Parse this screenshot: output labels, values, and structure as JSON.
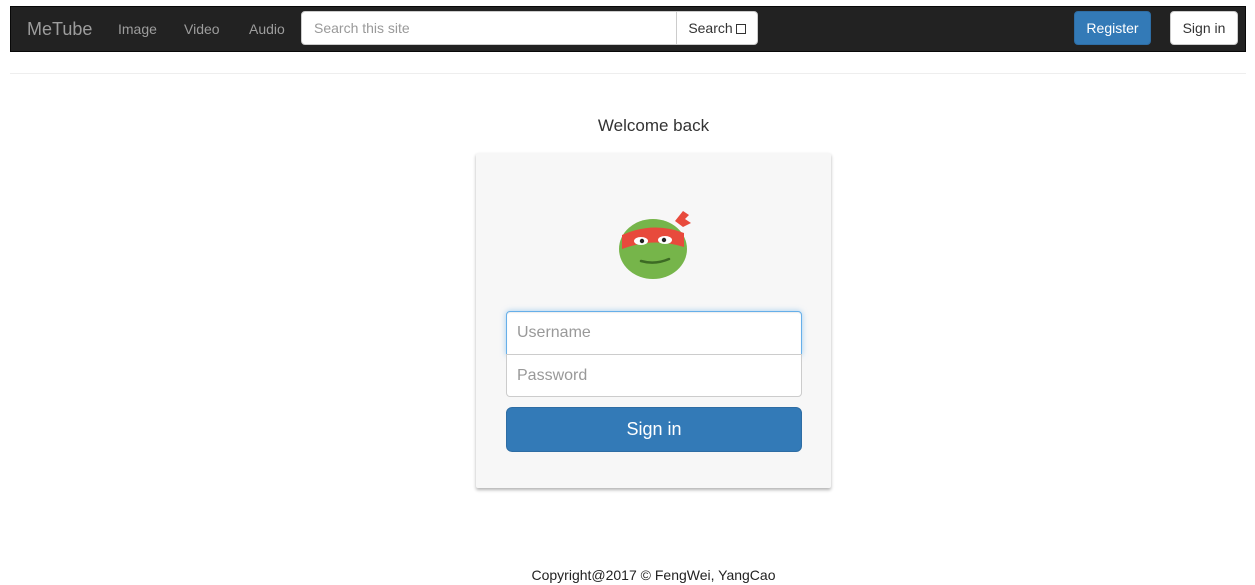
{
  "navbar": {
    "brand": "MeTube",
    "links": [
      "Image",
      "Video",
      "Audio"
    ],
    "search_placeholder": "Search this site",
    "search_button": "Search",
    "register": "Register",
    "sign_in": "Sign in"
  },
  "main": {
    "welcome": "Welcome back",
    "avatar_icon": "turtle-mascot-icon",
    "username_placeholder": "Username",
    "password_placeholder": "Password",
    "sign_in_button": "Sign in"
  },
  "footer": {
    "copyright": "Copyright@2017 © FengWei, YangCao"
  },
  "colors": {
    "navbar_bg": "#222222",
    "primary": "#337ab7"
  }
}
